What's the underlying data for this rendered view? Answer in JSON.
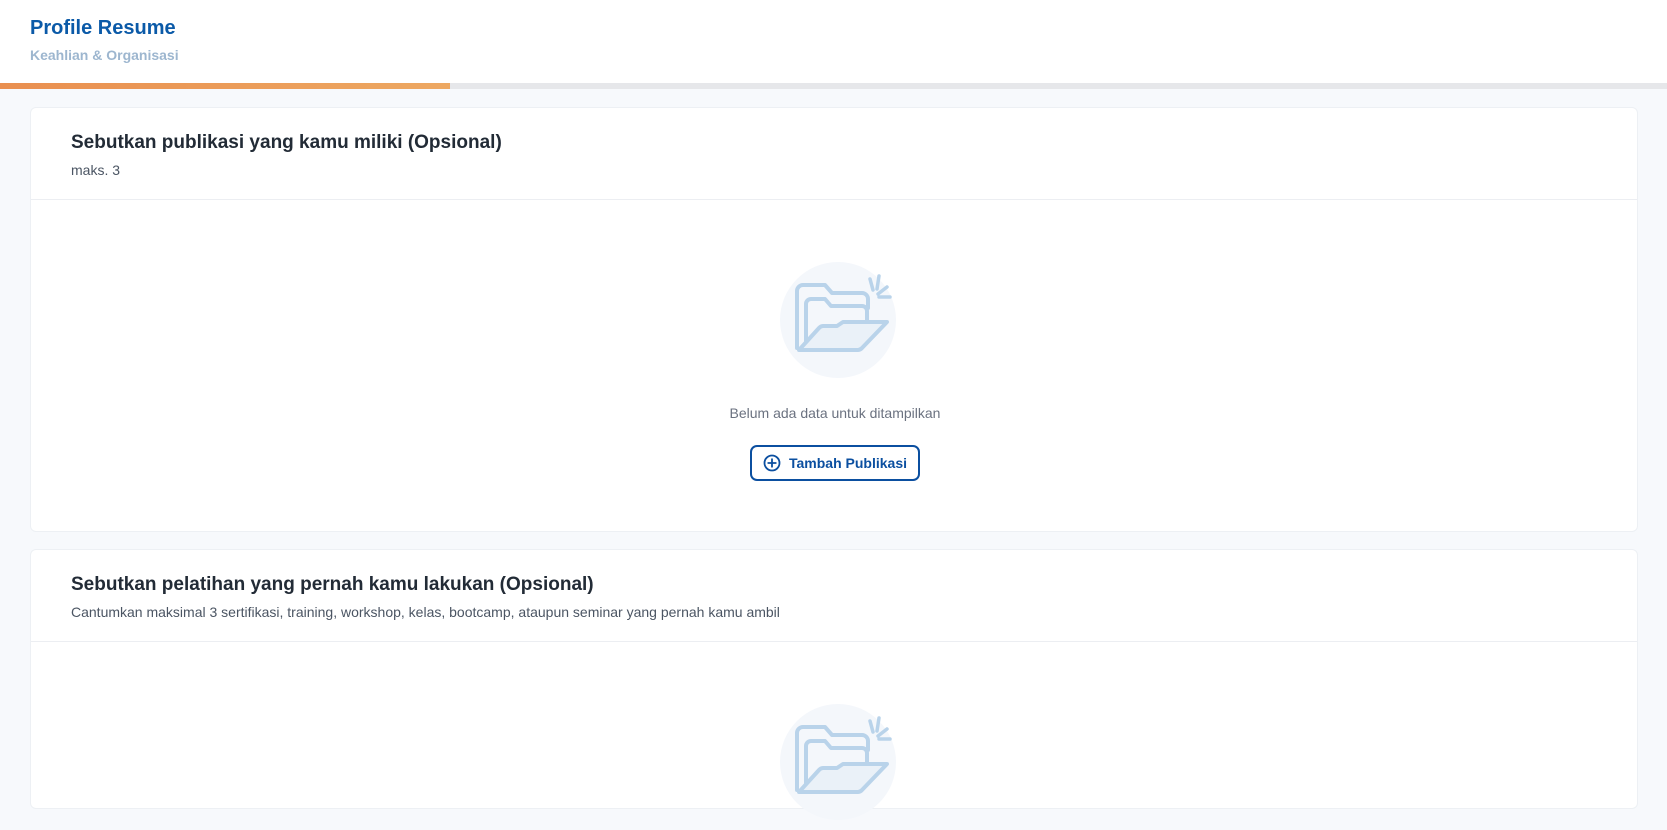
{
  "header": {
    "title": "Profile Resume",
    "subtitle": "Keahlian & Organisasi",
    "progress_percent": 27,
    "progress_color": "#ea9a58"
  },
  "sections": [
    {
      "title": "Sebutkan publikasi yang kamu miliki (Opsional)",
      "description": "maks. 3",
      "empty_icon": "open-folder-icon",
      "empty_text": "Belum ada data untuk ditampilkan",
      "button_label": "Tambah Publikasi",
      "button_icon": "plus-circle-icon"
    },
    {
      "title": "Sebutkan pelatihan yang pernah kamu lakukan (Opsional)",
      "description": "Cantumkan maksimal 3 sertifikasi, training, workshop, kelas, bootcamp, ataupun seminar yang pernah kamu ambil",
      "empty_icon": "open-folder-icon"
    }
  ],
  "colors": {
    "primary": "#0b4fa0",
    "title_blue": "#0b5aa8",
    "subtitle_blue": "#9db6cf",
    "icon_blue": "#b9d3ea"
  }
}
